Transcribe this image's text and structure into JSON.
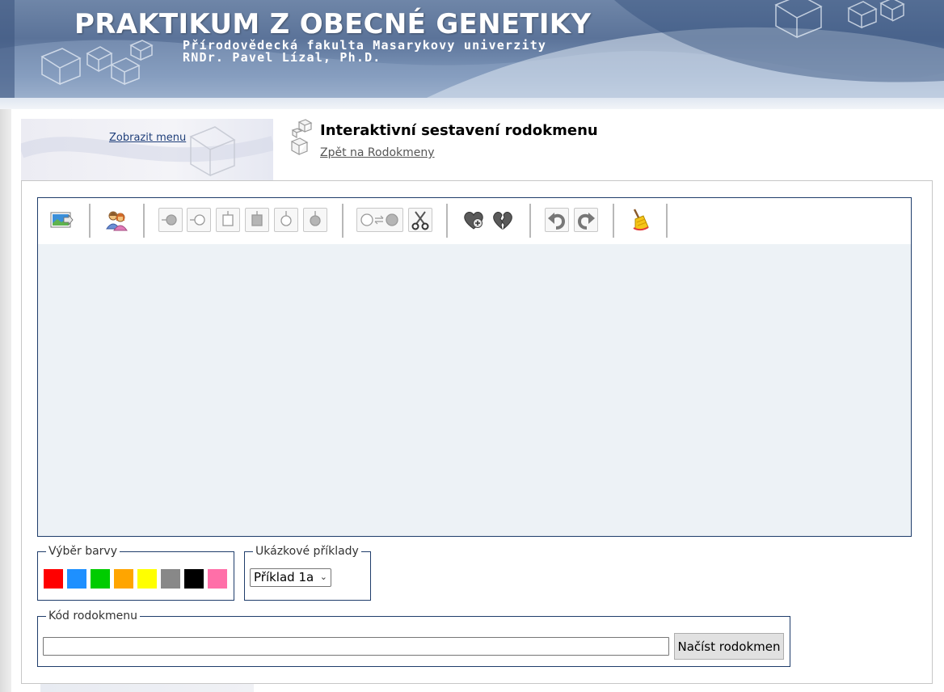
{
  "banner": {
    "title": "PRAKTIKUM Z OBECNÉ GENETIKY",
    "subtitle_faculty": "Přírodovědecká fakulta Masarykovy univerzity",
    "subtitle_author": "RNDr. Pavel Lízal, Ph.D."
  },
  "menu": {
    "show_menu_link": "Zobrazit menu"
  },
  "header": {
    "title": "Interaktivní sestavení rodokmenu",
    "back_link": "Zpět na Rodokmeny"
  },
  "toolbar": {
    "buttons": [
      "export-image-icon",
      "add-couple-icon",
      "male-affected-left-connector-icon",
      "female-unaffected-left-connector-icon",
      "square-unaffected-icon",
      "square-affected-icon",
      "circle-unaffected-icon",
      "circle-affected-icon",
      "connect-nodes-icon",
      "cut-scissors-icon",
      "add-heart-icon",
      "broken-heart-icon",
      "undo-icon",
      "redo-icon",
      "clear-broom-icon"
    ]
  },
  "colors": {
    "legend": "Výběr barvy",
    "swatches": [
      "#ff0000",
      "#1e90ff",
      "#00cc00",
      "#ffa500",
      "#ffff00",
      "#888888",
      "#000000",
      "#ff6fa8"
    ]
  },
  "examples": {
    "legend": "Ukázkové příklady",
    "selected": "Příklad 1a"
  },
  "code": {
    "legend": "Kód rodokmenu",
    "input_value": "",
    "load_button": "Načíst rodokmen"
  },
  "theme": {
    "border_color": "#1f3d6b",
    "canvas_bg": "#edf2f6",
    "link_color": "#1f3f7a"
  }
}
